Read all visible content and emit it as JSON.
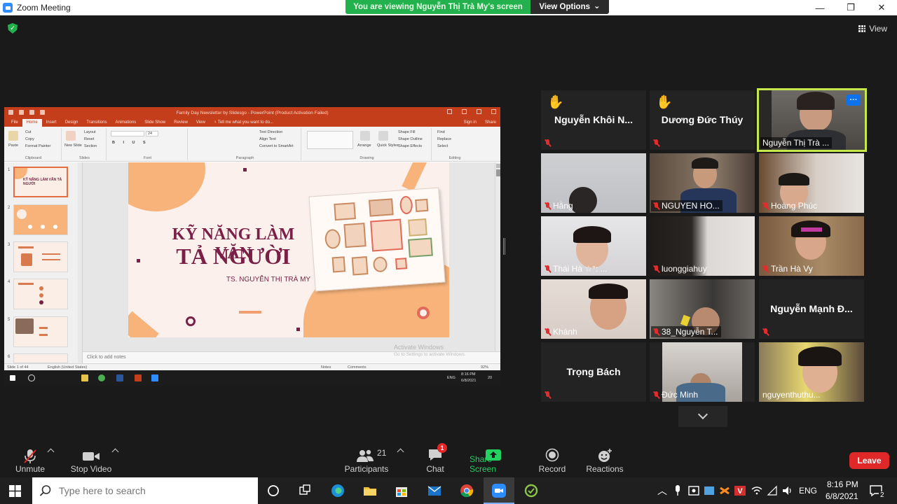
{
  "window": {
    "title": "Zoom Meeting",
    "minimize_glyph": "—",
    "restore_glyph": "❐",
    "close_glyph": "✕"
  },
  "banner": {
    "message": "You are viewing Nguyễn Thị Trà My's screen",
    "view_options_label": "View Options",
    "chevron_glyph": "⌄"
  },
  "header": {
    "view_label": "View",
    "shield_glyph": "✓"
  },
  "shared_screen": {
    "ppt_title": "Family Day Newsletter by Slidesgo - PowerPoint (Product Activation Failed)",
    "tabs": [
      "File",
      "Home",
      "Insert",
      "Design",
      "Transitions",
      "Animations",
      "Slide Show",
      "Review",
      "View"
    ],
    "tell_me": "♀ Tell me what you want to do...",
    "sign_in": "Sign in",
    "share": "Share",
    "ribbon": {
      "paste": "Paste",
      "cut": "Cut",
      "copy": "Copy",
      "format_painter": "Format Painter",
      "new_slide": "New Slide",
      "layout": "Layout",
      "reset": "Reset",
      "section": "Section",
      "font_size": "24",
      "text_direction": "Text Direction",
      "align_text": "Align Text",
      "convert_smartart": "Convert to SmartArt",
      "arrange": "Arrange",
      "quick_styles": "Quick Styles",
      "shape_fill": "Shape Fill",
      "shape_outline": "Shape Outline",
      "shape_effects": "Shape Effects",
      "find": "Find",
      "replace": "Replace",
      "select": "Select",
      "groups": [
        "Clipboard",
        "Slides",
        "Font",
        "Paragraph",
        "Drawing",
        "Editing"
      ]
    },
    "thumb_numbers": [
      "1",
      "2",
      "3",
      "4",
      "5",
      "6"
    ],
    "thumb1_text": "KỸ NĂNG LÀM VĂN TẢ NGƯỜI",
    "slide": {
      "title_line1": "KỸ NĂNG LÀM VĂN",
      "title_line2": "TẢ NGƯỜI",
      "author": "TS. NGUYỄN THỊ TRÀ MY"
    },
    "notes_placeholder": "Click to add notes",
    "activate_windows": "Activate Windows",
    "activate_windows_sub": "Go to Settings to activate Windows.",
    "status": {
      "slide_of": "Slide 1 of 44",
      "language": "English (United States)",
      "notes": "Notes",
      "comments": "Comments",
      "zoom": "92%"
    },
    "remote_taskbar": {
      "lang": "ENG",
      "time": "8:16 PM",
      "date": "6/8/2021",
      "notif": "20"
    }
  },
  "participants_grid": [
    {
      "name": "Nguyễn  Khôi  N...",
      "label": "",
      "raised_hand": true,
      "muted": true,
      "video": false
    },
    {
      "name": "Dương Đức Thúy",
      "label": "",
      "raised_hand": true,
      "muted": true,
      "video": false
    },
    {
      "name": "",
      "label": "Nguyễn Thị Trà ...",
      "raised_hand": false,
      "muted": false,
      "video": true,
      "active": true
    },
    {
      "name": "",
      "label": "Hằng",
      "muted": true,
      "video": true
    },
    {
      "name": "",
      "label": "NGUYEN HO...",
      "muted": true,
      "video": true
    },
    {
      "name": "",
      "label": "Hoàng Phúc",
      "muted": true,
      "video": true
    },
    {
      "name": "",
      "label": "Thái Hà ☆°: ...",
      "muted": true,
      "video": true
    },
    {
      "name": "",
      "label": "luonggiahuy",
      "muted": true,
      "video": true
    },
    {
      "name": "",
      "label": "Trần Hà Vy",
      "muted": true,
      "video": true
    },
    {
      "name": "",
      "label": "Khánh",
      "muted": true,
      "video": true
    },
    {
      "name": "",
      "label": "38_Nguyễn T...",
      "muted": true,
      "video": true
    },
    {
      "name": "Nguyễn  Mạnh  Đ...",
      "label": "",
      "muted": true,
      "video": false
    },
    {
      "name": "Trọng Bách",
      "label": "",
      "muted": true,
      "video": false
    },
    {
      "name": "",
      "label": "Đức Minh",
      "muted": true,
      "video": true
    },
    {
      "name": "",
      "label": "nguyenthuthu...",
      "muted": false,
      "video": true
    }
  ],
  "hand_glyph": "✋",
  "more_glyph": "···",
  "toolbar": {
    "unmute": "Unmute",
    "stop_video": "Stop Video",
    "participants": "Participants",
    "participants_count": "21",
    "chat": "Chat",
    "chat_badge": "1",
    "share_screen": "Share Screen",
    "record": "Record",
    "reactions": "Reactions",
    "leave": "Leave"
  },
  "taskbar": {
    "search_placeholder": "Type here to search",
    "lang": "ENG",
    "time": "8:16 PM",
    "date": "6/8/2021",
    "notification_count": "2"
  },
  "colors": {
    "zoom_green": "#23b14d",
    "zoom_blue": "#2d8cff",
    "leave_red": "#e02828",
    "ppt_red": "#c43e1c",
    "slide_maroon": "#7a1f45",
    "slide_orange": "#f7b37a",
    "active_speaker": "#c6e84a"
  }
}
